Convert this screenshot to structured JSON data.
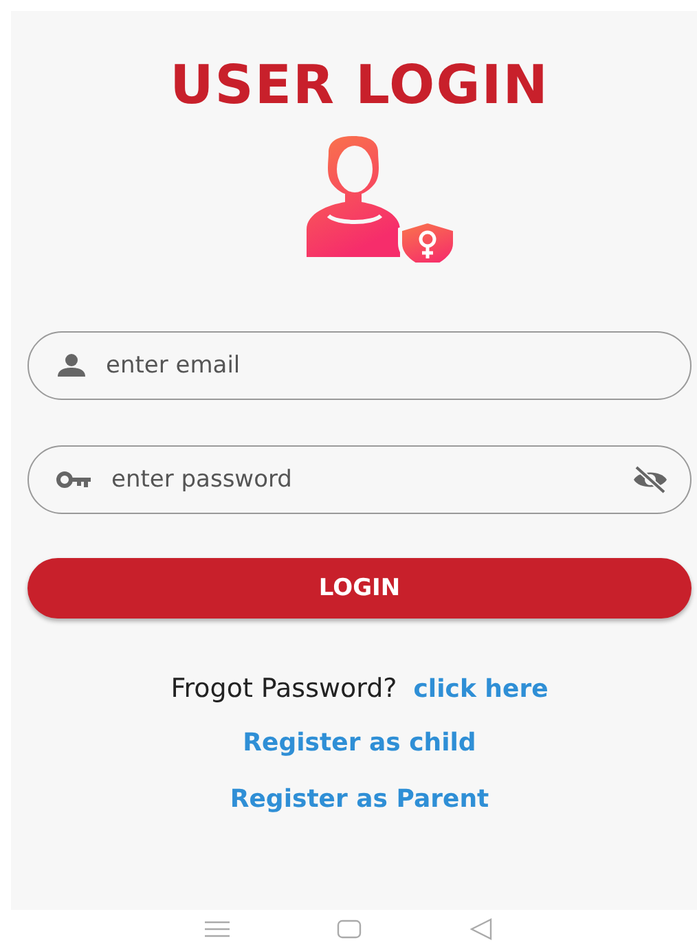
{
  "title": "USER LOGIN",
  "fields": [
    {
      "kind": "email",
      "placeholder": "enter email"
    },
    {
      "kind": "password",
      "placeholder": "enter password",
      "password_visible": false
    }
  ],
  "login_button": "LOGIN",
  "forgot": {
    "text": "Frogot Password?",
    "link": "click here"
  },
  "links": [
    "Register as child",
    "Register as Parent"
  ]
}
